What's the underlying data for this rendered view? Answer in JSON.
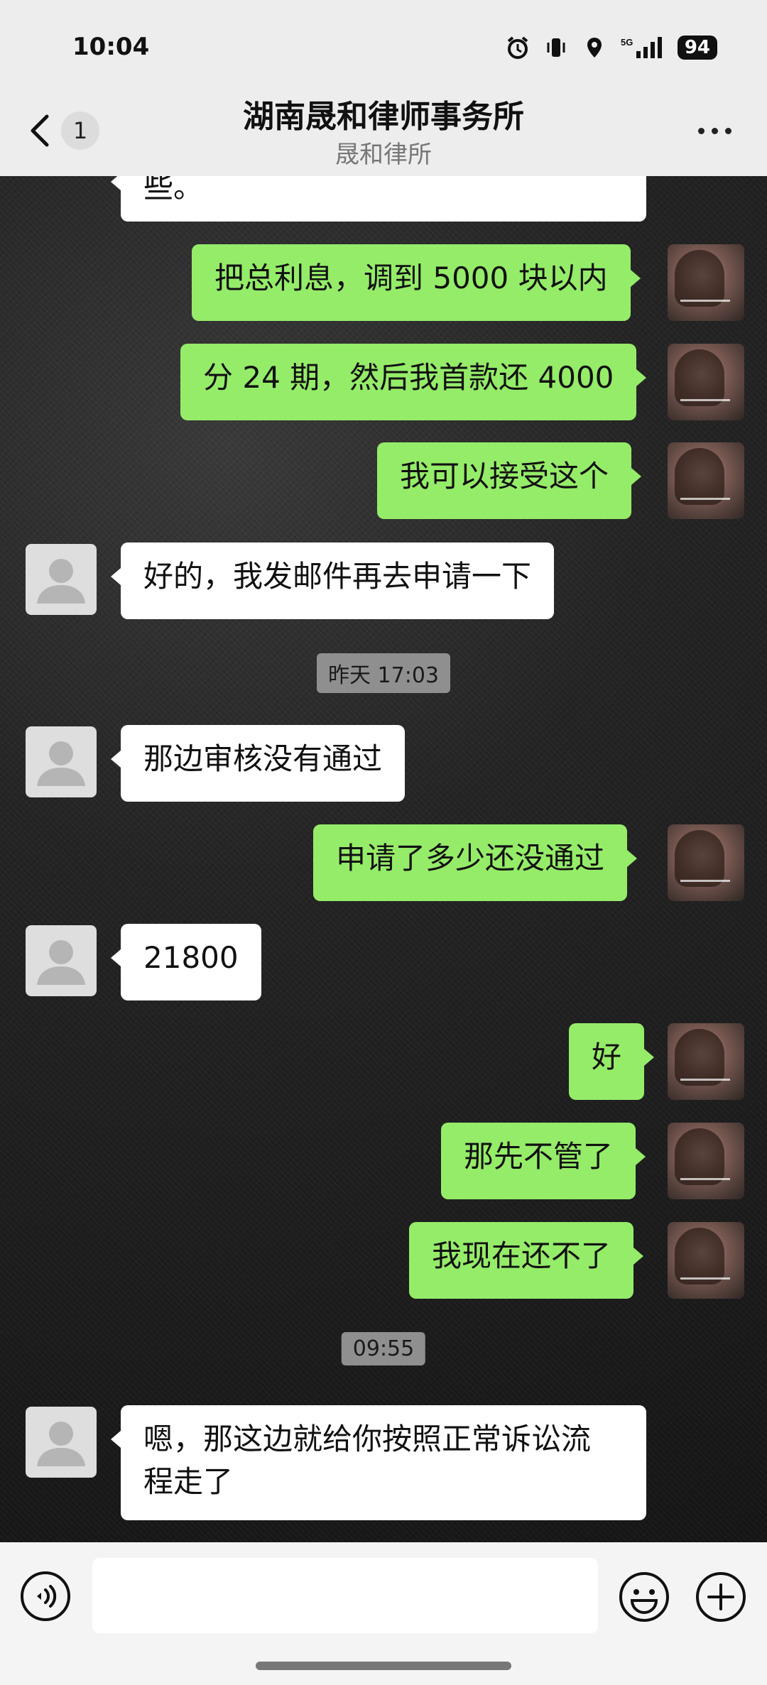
{
  "status": {
    "time": "10:04",
    "battery": "94"
  },
  "header": {
    "title": "湖南晟和律师事务所",
    "subtitle": "晟和律所",
    "unread_badge": "1"
  },
  "messages": [
    {
      "side": "in",
      "text": "些。"
    },
    {
      "side": "out",
      "text": "把总利息，调到 5000 块以内"
    },
    {
      "side": "out",
      "text": "分 24 期，然后我首款还 4000"
    },
    {
      "side": "out",
      "text": "我可以接受这个"
    },
    {
      "side": "in",
      "text": "好的，我发邮件再去申请一下"
    },
    {
      "side": "in",
      "text": "那边审核没有通过"
    },
    {
      "side": "out",
      "text": "申请了多少还没通过"
    },
    {
      "side": "in",
      "text": "21800"
    },
    {
      "side": "out",
      "text": "好"
    },
    {
      "side": "out",
      "text": "那先不管了"
    },
    {
      "side": "out",
      "text": "我现在还不了"
    },
    {
      "side": "in",
      "text_line1": "嗯，那这边就给你按照正常诉讼流",
      "text_line2": "程走了"
    }
  ],
  "timestamps": [
    "昨天 17:03",
    "09:55"
  ],
  "colors": {
    "out_bubble": "#95ec69",
    "in_bubble": "#ffffff",
    "header_bg": "#ededed"
  }
}
